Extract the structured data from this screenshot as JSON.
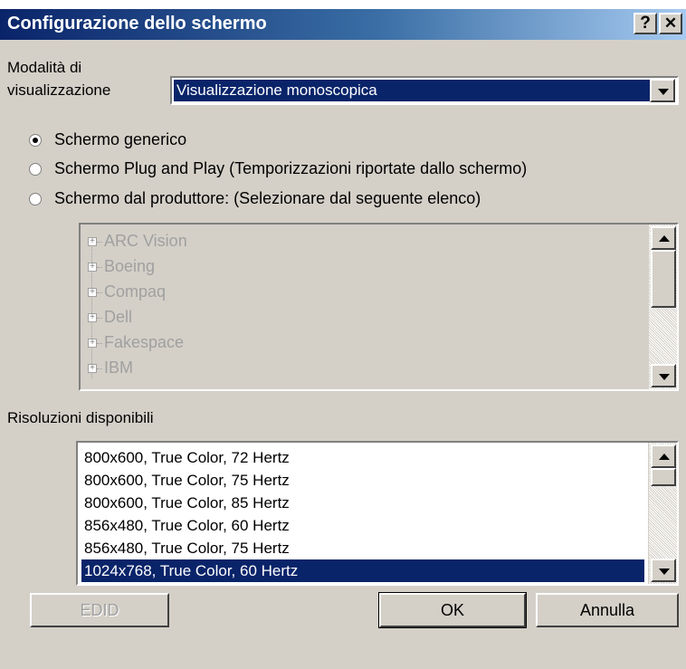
{
  "window": {
    "title": "Configurazione dello schermo",
    "help_label": "?",
    "close_label": "✕"
  },
  "display_mode": {
    "label_line1": "Modalità di",
    "label_line2": "visualizzazione",
    "selected_value": "Visualizzazione monoscopica"
  },
  "screen_options": [
    {
      "label": "Schermo generico",
      "checked": true
    },
    {
      "label": "Schermo Plug and Play (Temporizzazioni riportate dallo schermo)",
      "checked": false
    },
    {
      "label": "Schermo dal produttore: (Selezionare dal seguente elenco)",
      "checked": false
    }
  ],
  "manufacturers": {
    "items": [
      "ARC Vision",
      "Boeing",
      "Compaq",
      "Dell",
      "Fakespace",
      "IBM"
    ],
    "enabled": false
  },
  "resolutions": {
    "label": "Risoluzioni disponibili",
    "items": [
      "800x600, True Color, 72 Hertz",
      "800x600, True Color, 75 Hertz",
      "800x600, True Color, 85 Hertz",
      "856x480, True Color, 60 Hertz",
      "856x480, True Color, 75 Hertz",
      "1024x768, True Color, 60 Hertz"
    ],
    "selected_index": 5
  },
  "buttons": {
    "edid": "EDID",
    "ok": "OK",
    "cancel": "Annulla"
  },
  "colors": {
    "selection": "#0a246a",
    "face": "#d4d0c8"
  }
}
